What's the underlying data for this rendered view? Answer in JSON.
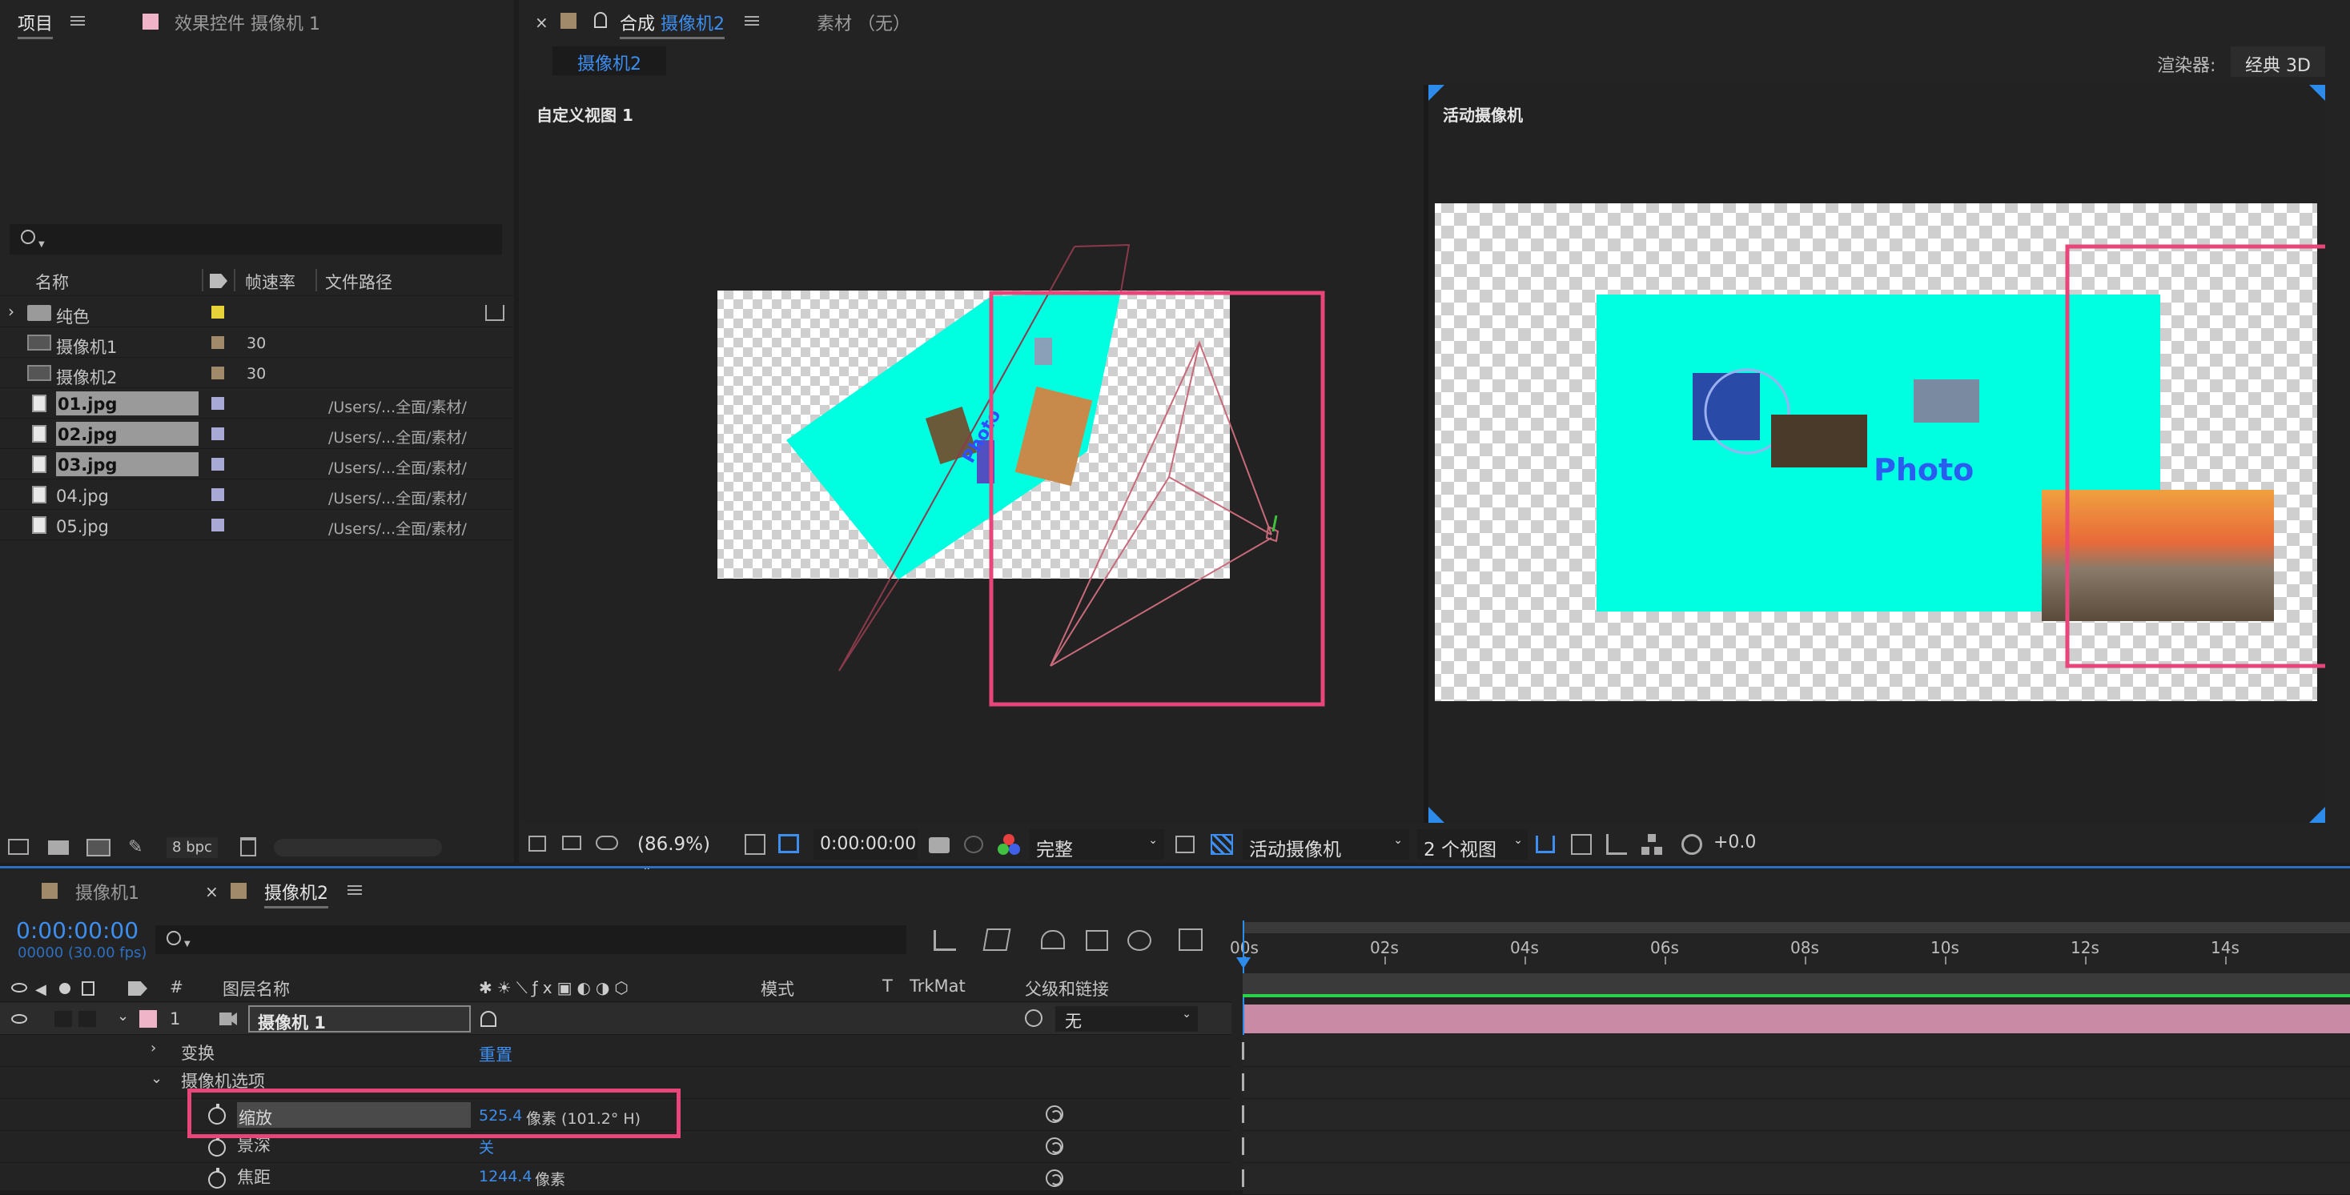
{
  "project_panel": {
    "tab_project": "项目",
    "tab_effects": "效果控件 摄像机 1",
    "search_placeholder": "",
    "columns": {
      "name": "名称",
      "fps": "帧速率",
      "path": "文件路径"
    },
    "items": [
      {
        "name": "纯色",
        "type": "folder",
        "fps": "",
        "path": "",
        "swatch": "#e8d23a"
      },
      {
        "name": "摄像机1",
        "type": "comp",
        "fps": "30",
        "path": "",
        "swatch": "#a08a6a"
      },
      {
        "name": "摄像机2",
        "type": "comp",
        "fps": "30",
        "path": "",
        "swatch": "#a08a6a"
      },
      {
        "name": "01.jpg",
        "type": "file",
        "fps": "",
        "path": "/Users/...全面/素材/",
        "swatch": "#a9a9d6",
        "selected": true
      },
      {
        "name": "02.jpg",
        "type": "file",
        "fps": "",
        "path": "/Users/...全面/素材/",
        "swatch": "#a9a9d6",
        "selected": true
      },
      {
        "name": "03.jpg",
        "type": "file",
        "fps": "",
        "path": "/Users/...全面/素材/",
        "swatch": "#a9a9d6",
        "selected": true
      },
      {
        "name": "04.jpg",
        "type": "file",
        "fps": "",
        "path": "/Users/...全面/素材/",
        "swatch": "#a9a9d6"
      },
      {
        "name": "05.jpg",
        "type": "file",
        "fps": "",
        "path": "/Users/...全面/素材/",
        "swatch": "#a9a9d6"
      }
    ],
    "bpc": "8 bpc"
  },
  "comp_panel": {
    "close": "×",
    "tab_prefix": "合成",
    "tab_comp": "摄像机2",
    "tab_footage": "素材 （无）",
    "sub_tab": "摄像机2",
    "renderer_label": "渲染器:",
    "renderer_value": "经典 3D",
    "left_view_label": "自定义视图 1",
    "right_view_label": "活动摄像机",
    "photo_text": "Photo",
    "toolbar": {
      "zoom": "(86.9%)",
      "timecode": "0:00:00:00",
      "resolution": "完整",
      "camera": "活动摄像机",
      "views": "2 个视图",
      "exposure": "+0.0"
    }
  },
  "timeline": {
    "tab1": "摄像机1",
    "tab2": "摄像机2",
    "close": "×",
    "timecode": "0:00:00:00",
    "frame_info": "00000 (30.00 fps)",
    "search_placeholder": "",
    "columns": {
      "num": "#",
      "layer_name": "图层名称",
      "mode": "模式",
      "t": "T",
      "trkmat": "TrkMat",
      "parent": "父级和链接"
    },
    "ticks": [
      "00s",
      "02s",
      "04s",
      "06s",
      "08s",
      "10s",
      "12s",
      "14s"
    ],
    "layer": {
      "index": "1",
      "name": "摄像机 1",
      "parent": "无"
    },
    "transform_label": "变换",
    "transform_reset": "重置",
    "camera_options_label": "摄像机选项",
    "props": [
      {
        "name": "缩放",
        "value": "525.4",
        "unit": "像素 (101.2° H)"
      },
      {
        "name": "景深",
        "value": "关",
        "unit": ""
      },
      {
        "name": "焦距",
        "value": "1244.4",
        "unit": "像素"
      }
    ]
  },
  "colors": {
    "accent": "#3d8eef",
    "highlight": "#e8457a",
    "cyan": "#00ffe0",
    "layer_bar": "#c98aa6"
  }
}
